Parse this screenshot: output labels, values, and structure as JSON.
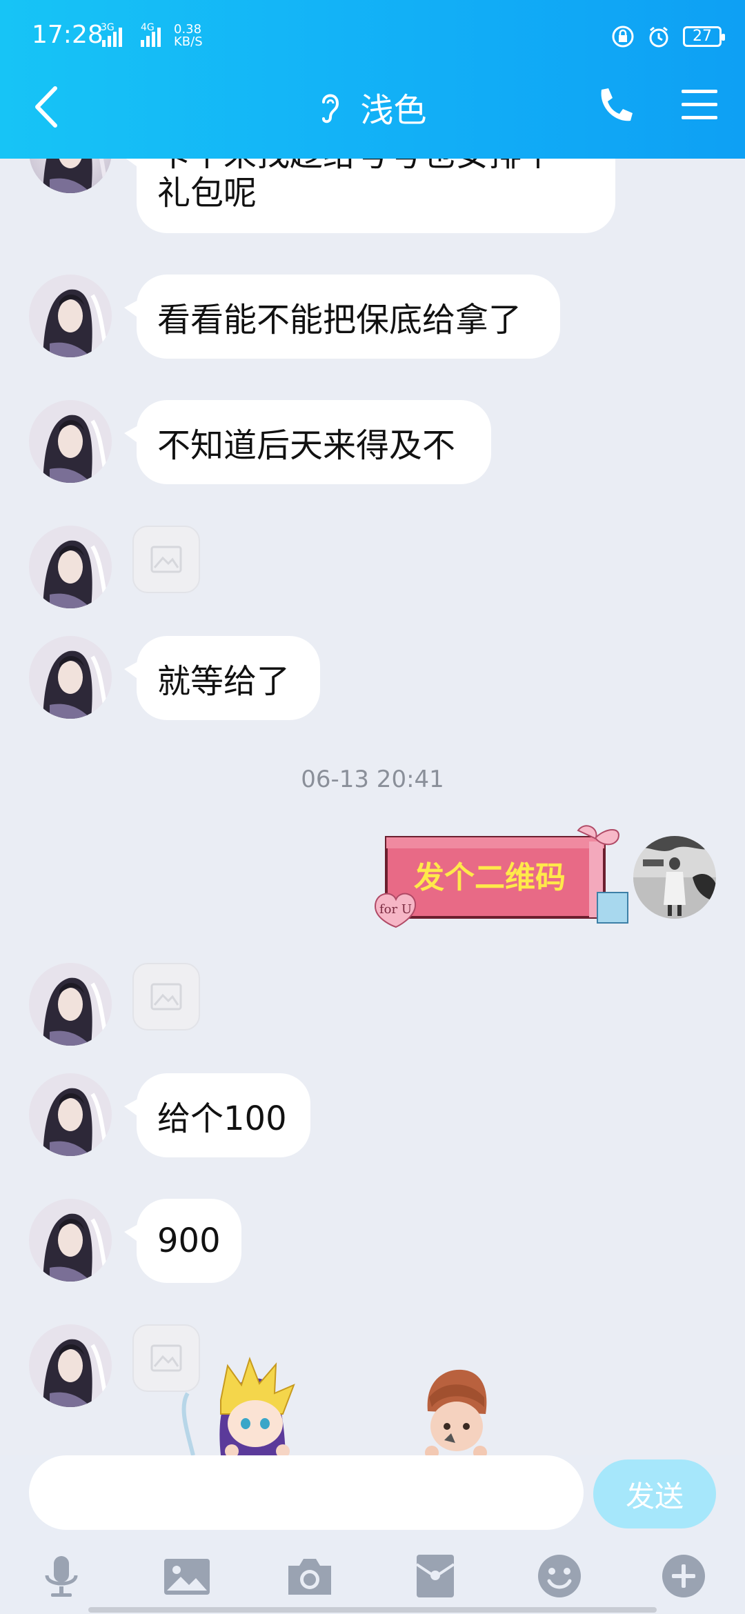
{
  "status_bar": {
    "time": "17:28",
    "network_1": "3G",
    "network_2": "4G",
    "speed_value": "0.38",
    "speed_unit": "KB/S",
    "battery": "27"
  },
  "header": {
    "title": "浅色",
    "back_icon": "chevron-left-icon",
    "ear_icon": "ear-icon",
    "call_icon": "phone-icon",
    "menu_icon": "menu-icon"
  },
  "messages": [
    {
      "side": "left",
      "type": "text",
      "line1": "卡个来找趁给号号也安排个",
      "line2": "礼包呢"
    },
    {
      "side": "left",
      "type": "text",
      "text": "看看能不能把保底给拿了"
    },
    {
      "side": "left",
      "type": "text",
      "text": "不知道后天来得及不"
    },
    {
      "side": "left",
      "type": "image"
    },
    {
      "side": "left",
      "type": "text",
      "text": "就等给了"
    },
    {
      "type": "timestamp",
      "text": "06-13 20:41"
    },
    {
      "side": "right",
      "type": "sticker",
      "sticker_text": "发个二维码",
      "tag_text": "for U"
    },
    {
      "side": "left",
      "type": "image"
    },
    {
      "side": "left",
      "type": "text",
      "text": "给个100"
    },
    {
      "side": "left",
      "type": "text",
      "text": "900"
    },
    {
      "side": "left",
      "type": "image"
    }
  ],
  "input": {
    "placeholder": "",
    "send_label": "发送"
  },
  "toolbar": [
    "microphone-icon",
    "image-icon",
    "camera-icon",
    "red-packet-icon",
    "emoji-icon",
    "plus-icon"
  ],
  "colors": {
    "header_start": "#17c4f6",
    "header_end": "#0ea0f4",
    "background": "#eaedf4",
    "send_button": "#a6e7fb",
    "toolbar_icon": "#9aa3b2"
  }
}
